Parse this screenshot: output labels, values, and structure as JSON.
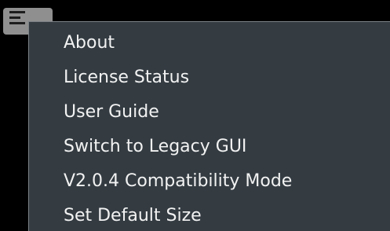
{
  "menu": {
    "items": [
      {
        "label": "About",
        "has_submenu": false
      },
      {
        "label": "License Status",
        "has_submenu": false
      },
      {
        "label": "User Guide",
        "has_submenu": true,
        "submenu_icon": "›"
      },
      {
        "label": "Switch to Legacy GUI",
        "has_submenu": false
      },
      {
        "label": "V2.0.4 Compatibility Mode",
        "has_submenu": false
      },
      {
        "label": "Set Default Size",
        "has_submenu": false
      }
    ]
  },
  "colors": {
    "background": "#000000",
    "menu_bg": "#343c42",
    "menu_text": "#f2f2f2",
    "button_bg": "#8f8f8f"
  }
}
